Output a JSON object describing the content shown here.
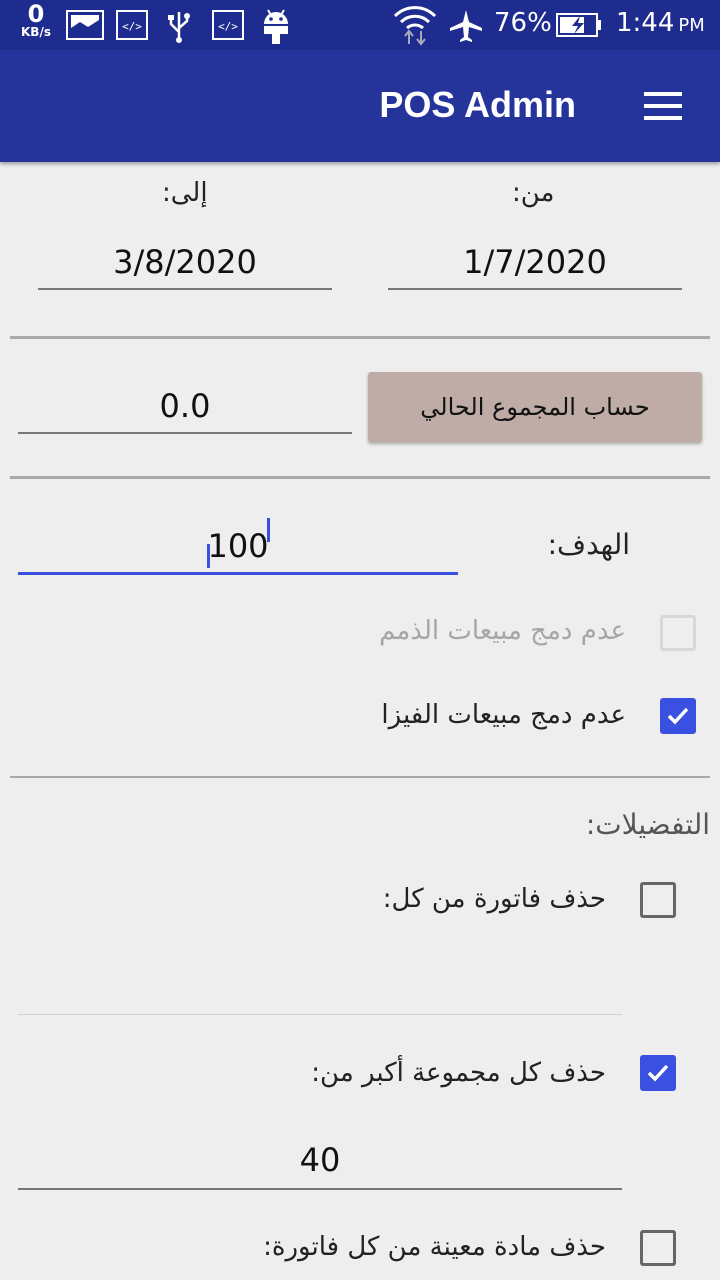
{
  "status_bar": {
    "network_speed_value": "0",
    "network_speed_unit": "KB/s",
    "battery_percent": "76%",
    "time": "1:44",
    "ampm": "PM"
  },
  "app_bar": {
    "title": "POS Admin"
  },
  "date_range": {
    "from_label": "من:",
    "from_value": "1/7/2020",
    "to_label": "إلى:",
    "to_value": "3/8/2020"
  },
  "current_total": {
    "button_label": "حساب المجموع الحالي",
    "value": "0.0"
  },
  "target": {
    "label": "الهدف:",
    "value": "100"
  },
  "options": {
    "no_merge_debt_label": "عدم دمج مبيعات الذمم",
    "no_merge_visa_label": "عدم دمج مبيعات الفيزا"
  },
  "preferences": {
    "title": "التفضيلات:",
    "delete_invoice_label": "حذف فاتورة من كل:",
    "delete_invoice_value": "",
    "delete_group_label": "حذف كل مجموعة أكبر من:",
    "delete_group_value": "40",
    "delete_item_label": "حذف مادة معينة من كل فاتورة:"
  },
  "colors": {
    "status_bar": "#1f2c8f",
    "app_bar": "#25349b",
    "accent": "#3950e0",
    "button": "#bfaca6"
  }
}
